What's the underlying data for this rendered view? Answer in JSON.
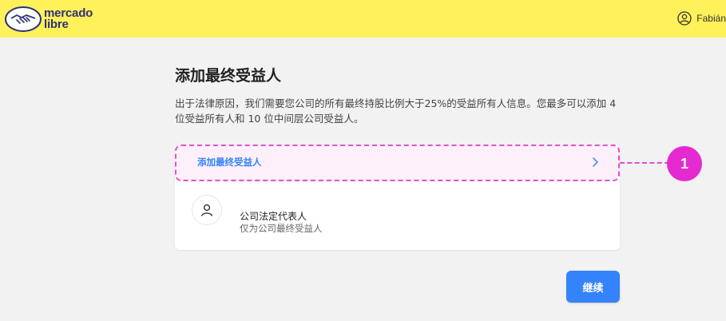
{
  "header": {
    "logo_line1": "mercado",
    "logo_line2": "libre",
    "logo_icon": "handshake-logo",
    "user_name": "Fabián",
    "user_icon": "user-circle-icon",
    "background_color": "#fff159"
  },
  "page": {
    "title": "添加最终受益人",
    "description": "出于法律原因，我们需要您公司的所有最终持股比例大于25%的受益所有人信息。您最多可以添加 4 位受益所有人和 10 位中间层公司受益人。"
  },
  "beneficiary_card": {
    "add_label": "添加最终受益人",
    "add_icon": "chevron-right-icon",
    "representative_title": "公司法定代表人",
    "representative_subtitle": "仅为公司最终受益人",
    "representative_icon": "person-icon"
  },
  "annotation": {
    "step_number": "1",
    "color": "#e62ad2"
  },
  "actions": {
    "continue_label": "继续",
    "accent_color": "#3483fa"
  }
}
